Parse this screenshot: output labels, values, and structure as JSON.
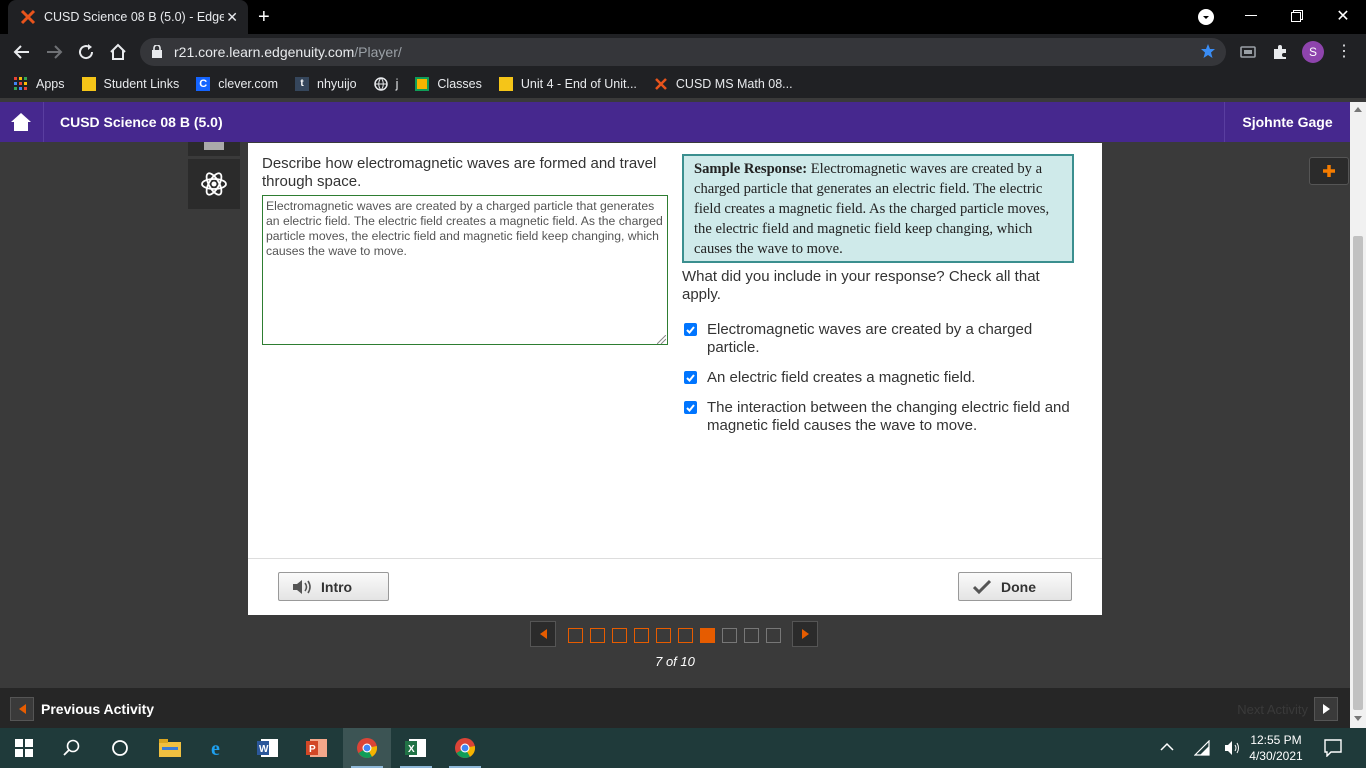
{
  "browser": {
    "tab_title": "CUSD Science 08 B (5.0) - Edgenuity",
    "url_host": "r21.core.learn.edgenuity.com",
    "url_path": "/Player/",
    "profile_initial": "S",
    "bookmarks": [
      {
        "label": "Apps",
        "icon": "apps-grid-icon"
      },
      {
        "label": "Student Links",
        "icon": "bookmark-yellow-icon"
      },
      {
        "label": "clever.com",
        "icon": "clever-icon"
      },
      {
        "label": "nhyuijo",
        "icon": "tumblr-icon"
      },
      {
        "label": "j",
        "icon": "globe-icon"
      },
      {
        "label": "Classes",
        "icon": "classroom-icon"
      },
      {
        "label": "Unit 4 - End of Unit...",
        "icon": "folder-yellow-icon"
      },
      {
        "label": "CUSD MS Math 08...",
        "icon": "edgenuity-x-icon"
      }
    ]
  },
  "header": {
    "course_title": "CUSD Science 08 B (5.0)",
    "user_name": "Sjohnte Gage"
  },
  "activity": {
    "prompt": "Describe how electromagnetic waves are formed and travel through space.",
    "answer_text": "Electromagnetic waves are created by a charged particle that generates an electric field. The electric field creates a magnetic field. As the charged particle moves, the electric field and magnetic field keep changing, which causes the wave to move.",
    "sample_label": "Sample Response:",
    "sample_text": " Electromagnetic waves are created by a charged particle that generates an electric field. The electric field creates a magnetic field. As the charged particle moves, the electric field and magnetic field keep changing, which causes the wave to move.",
    "question": "What did you include in your response? Check all that apply.",
    "checklist": [
      {
        "label": "Electromagnetic waves are created by a charged particle.",
        "checked": true
      },
      {
        "label": "An electric field creates a magnetic field.",
        "checked": true
      },
      {
        "label": "The interaction between the changing electric field and magnetic field causes the wave to move.",
        "checked": true
      }
    ],
    "intro_label": "Intro",
    "done_label": "Done"
  },
  "pager": {
    "current": 7,
    "total": 10,
    "label": "7 of 10"
  },
  "footer": {
    "prev_label": "Previous Activity",
    "next_label": "Next Activity"
  },
  "taskbar": {
    "time": "12:55 PM",
    "date": "4/30/2021"
  },
  "colors": {
    "purple": "#46288e",
    "orange": "#e65c00",
    "sample_bg": "#cfeaea",
    "checkbox": "#0075ff"
  }
}
